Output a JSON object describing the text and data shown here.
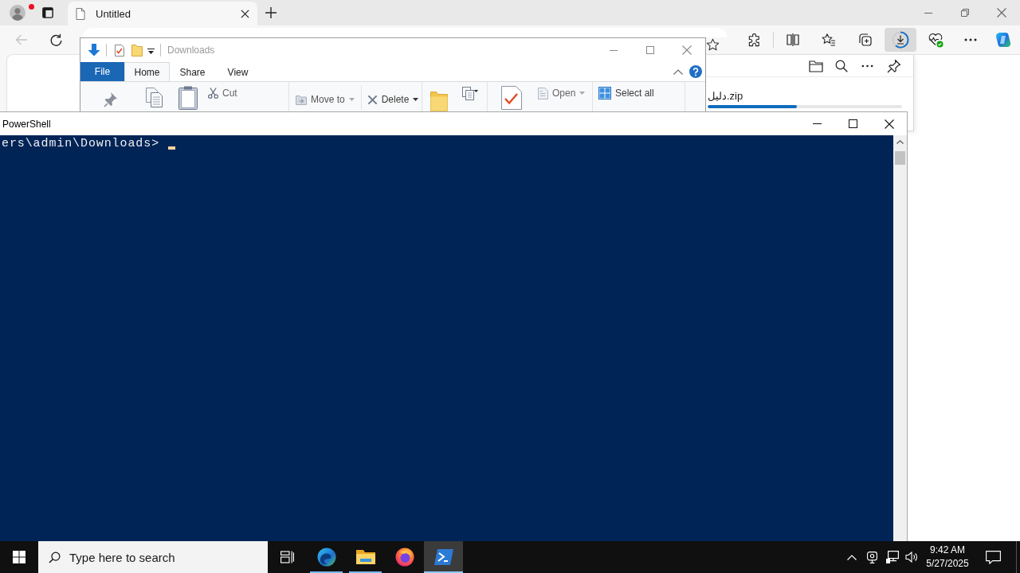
{
  "browser": {
    "profile": {
      "notification": true
    },
    "tabs": [
      {
        "title": "Untitled",
        "selected": true
      }
    ],
    "toolbar": {
      "back_disabled": true,
      "downloads_active": true
    },
    "downloads_panel": {
      "items": [
        {
          "name": "دليل.zip",
          "level": 0.46
        }
      ]
    }
  },
  "explorer": {
    "title": "Downloads",
    "file_menu": "File",
    "tabs": [
      {
        "label": "Home",
        "selected": true
      },
      {
        "label": "Share",
        "selected": false
      },
      {
        "label": "View",
        "selected": false
      }
    ],
    "commands": [
      {
        "label": "Cut",
        "dropdown": false
      },
      {
        "label": "Move to",
        "dropdown": true
      },
      {
        "label": "Delete",
        "dropdown": true
      },
      {
        "label": "Open",
        "dropdown": true
      },
      {
        "label": "Select all",
        "dropdown": false
      }
    ]
  },
  "powershell": {
    "title": "PowerShell",
    "lines": [
      "ers\\admin\\Downloads>"
    ]
  },
  "taskbar": {
    "search": {
      "placeholder": "Type here to search"
    },
    "apps": [
      {
        "running": true,
        "selected": false
      },
      {
        "running": true,
        "selected": false
      },
      {
        "running": false,
        "selected": false
      },
      {
        "running": true,
        "selected": true
      }
    ],
    "clock": {
      "time": "9:42 AM",
      "date": "5/27/2025"
    }
  }
}
